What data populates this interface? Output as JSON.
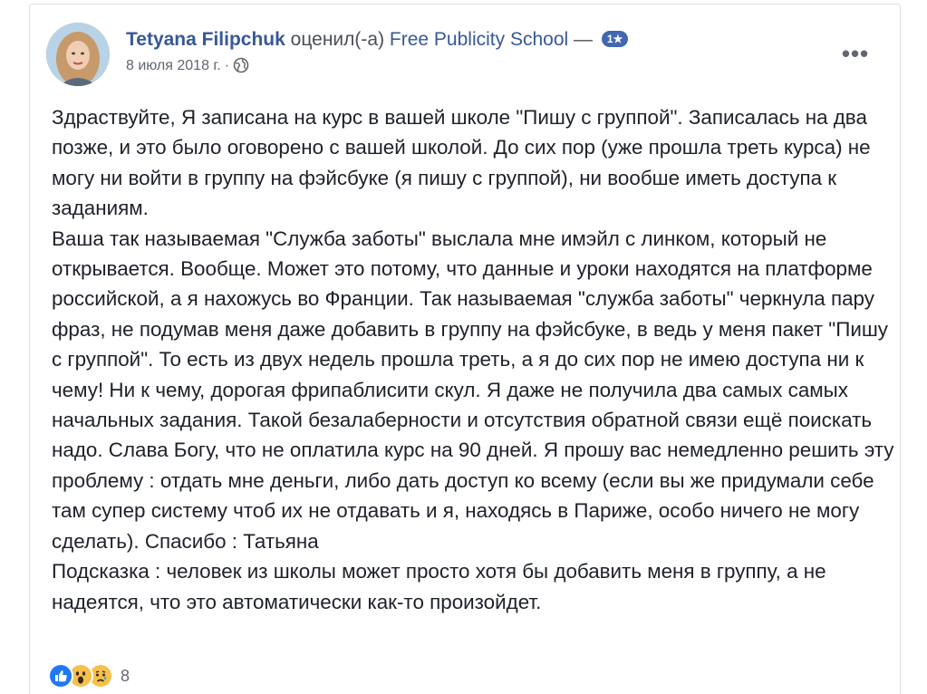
{
  "post": {
    "author": "Tetyana Filipchuk",
    "verb": "оценил(-а)",
    "page_name": "Free Publicity School",
    "dash": "—",
    "rating": "1★",
    "date": "8 июля 2018 г.",
    "separator": "·",
    "privacy_icon": "globe-icon",
    "more_icon": "ellipsis-icon",
    "body_paragraphs": [
      "Здраствуйте, Я записана на курс в вашей школе \"Пишу с группой\". Записалась на два позже, и это было оговорено с вашей школой. До сих пор (уже прошла треть курса) не могу ни войти в группу на фэйсбуке (я пишу с группой), ни вообше иметь доступа к заданиям.",
      "Ваша так называемая \"Служба заботы\" выслала мне имэйл с линком, который не открывается. Вообще. Может это потому, что данные и уроки находятся на платформе российской, а я нахожусь во Франции. Так называемая \"служба заботы\" черкнула пару фраз, не подумав меня даже добавить в группу на фэйсбуке, в ведь у меня пакет \"Пишу с группой\". То есть из двух недель прошла треть, а я до сих пор не имею доступа ни к чему! Ни к чему, дорогая фрипаблисити скул. Я даже не получила два самых самых начальных задания. Такой безалаберности и отсутствия обратной связи ещё поискать надо. Слава Богу, что не оплатила курс на 90 дней. Я прошу вас немедленно решить эту проблему : отдать мне деньги, либо дать доступ ко всему (если вы же придумали себе там супер систему чтоб их не отдавать и я, находясь в Париже, особо ничего не могу сделать). Спасибо : Татьяна",
      "Подсказка : человек из школы может просто хотя бы добавить меня в группу, а не надеятся, что это автоматически как-то произойдет."
    ],
    "reactions": {
      "icons": [
        "like-icon",
        "wow-icon",
        "sad-icon"
      ],
      "count": "8"
    }
  },
  "colors": {
    "link": "#385898",
    "text": "#1d2129",
    "meta": "#616770",
    "badge": "#4267b2",
    "like": "#2078f4",
    "emoji": "#f7c04a"
  }
}
